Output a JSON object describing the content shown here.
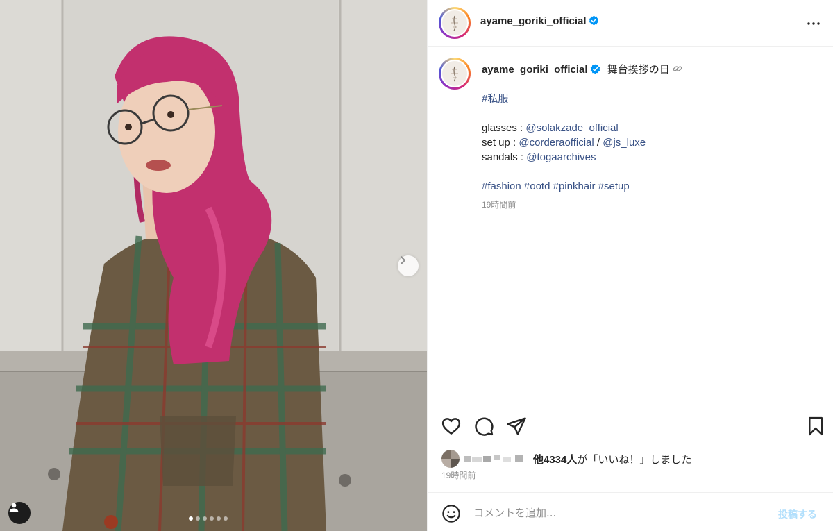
{
  "post": {
    "username": "ayame_goriki_official",
    "caption_text": "舞台挨拶の日",
    "hashtag_line1": "#私服",
    "credits": [
      {
        "label": "glasses : ",
        "mentions": [
          "@solakzade_official"
        ]
      },
      {
        "label": "set up : ",
        "mentions": [
          "@corderaofficial",
          "@js_luxe"
        ]
      },
      {
        "label": "sandals : ",
        "mentions": [
          "@togaarchives"
        ]
      }
    ],
    "credit_separator": " / ",
    "hashtags": [
      "#fashion",
      "#ootd",
      "#pinkhair",
      "#setup"
    ],
    "caption_time": "19時間前"
  },
  "likes": {
    "count_text": "他4334人",
    "suffix": "が「いいね！」しました"
  },
  "post_time": "19時間前",
  "comment": {
    "placeholder": "コメントを追加...",
    "post_button": "投稿する"
  },
  "carousel": {
    "slide_count": 6,
    "current_index": 0
  },
  "icons": {
    "more": "more-icon",
    "like": "heart-icon",
    "comment": "comment-icon",
    "share": "share-icon",
    "save": "bookmark-icon",
    "emoji": "emoji-icon",
    "verified": "verified-badge-icon",
    "next": "chevron-right-icon",
    "tag": "user-tag-icon"
  },
  "colors": {
    "verified_blue": "#0095f6",
    "link": "#385185",
    "hair": "#c2306e"
  }
}
